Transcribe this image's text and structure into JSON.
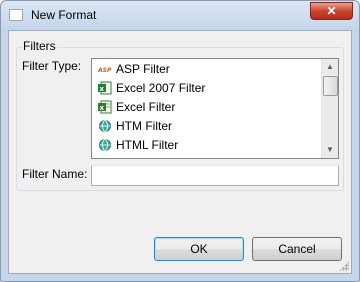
{
  "window": {
    "title": "New Format",
    "close_label": "✕"
  },
  "group": {
    "legend": "Filters"
  },
  "filter_type": {
    "label": "Filter Type:",
    "items": [
      {
        "label": "ASP Filter",
        "icon": "asp-icon"
      },
      {
        "label": "Excel 2007 Filter",
        "icon": "excel-icon"
      },
      {
        "label": "Excel Filter",
        "icon": "excel-icon"
      },
      {
        "label": "HTM Filter",
        "icon": "web-icon"
      },
      {
        "label": "HTML Filter",
        "icon": "web-icon"
      }
    ]
  },
  "filter_name": {
    "label": "Filter Name:",
    "value": ""
  },
  "buttons": {
    "ok": "OK",
    "cancel": "Cancel"
  }
}
